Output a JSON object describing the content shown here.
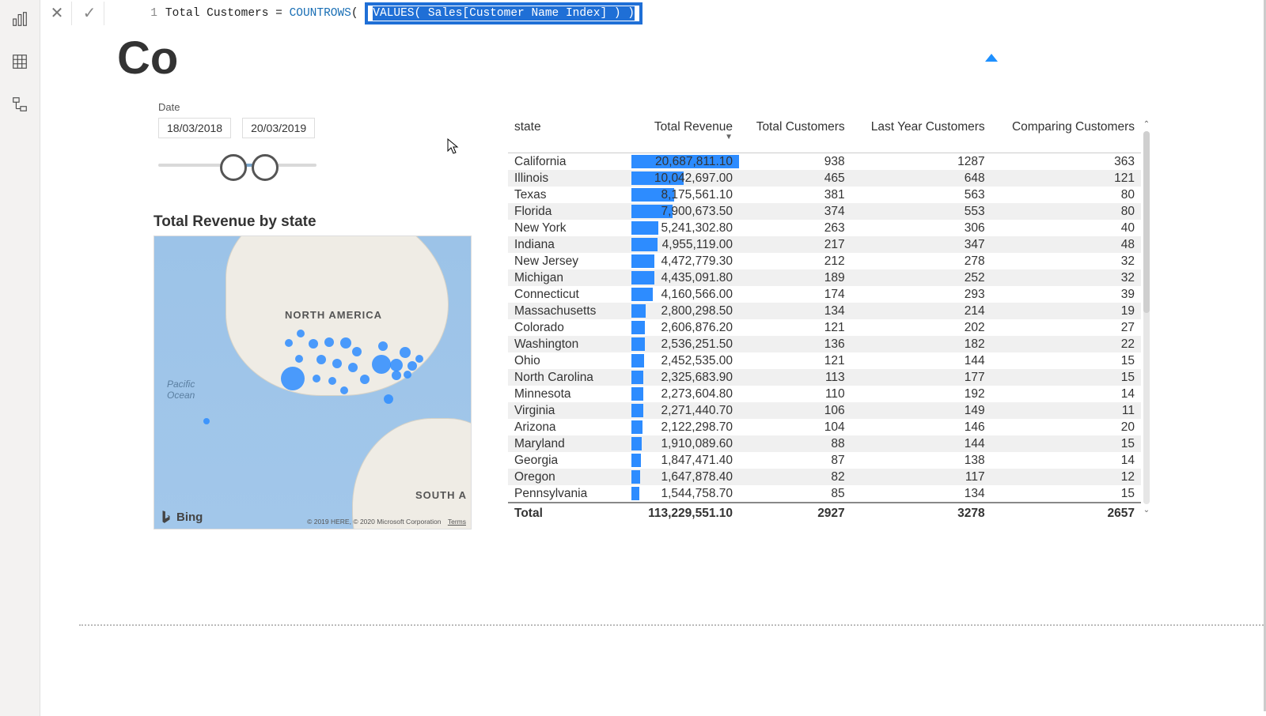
{
  "formula": {
    "line_no": "1",
    "measure_name": "Total Customers",
    "eq": " = ",
    "fn_left": "COUNTROWS",
    "paren_left": "( ",
    "fn_right": "VALUES",
    "inner_paren_l": "( ",
    "col_ref": "Sales[Customer Name Index]",
    "inner_paren_r": " )",
    "paren_right": " )"
  },
  "title_fragment": "Co",
  "date": {
    "label": "Date",
    "start": "18/03/2018",
    "end": "20/03/2019"
  },
  "map": {
    "title": "Total Revenue by state",
    "na_label": "NORTH AMERICA",
    "sa_label": "SOUTH A",
    "ocean_label": "Pacific\nOcean",
    "bing": "Bing",
    "credits": "© 2019 HERE, © 2020 Microsoft Corporation",
    "terms": "Terms"
  },
  "table": {
    "headers": {
      "state": "state",
      "rev": "Total Revenue",
      "cust": "Total Customers",
      "ly": "Last Year Customers",
      "comp": "Comparing Customers",
      "sort_glyph": "▼"
    },
    "rows": [
      {
        "state": "California",
        "revenue": "20,687,811.10",
        "cust": "938",
        "ly": "1287",
        "comp": "363"
      },
      {
        "state": "Illinois",
        "revenue": "10,042,697.00",
        "cust": "465",
        "ly": "648",
        "comp": "121"
      },
      {
        "state": "Texas",
        "revenue": "8,175,561.10",
        "cust": "381",
        "ly": "563",
        "comp": "80"
      },
      {
        "state": "Florida",
        "revenue": "7,900,673.50",
        "cust": "374",
        "ly": "553",
        "comp": "80"
      },
      {
        "state": "New York",
        "revenue": "5,241,302.80",
        "cust": "263",
        "ly": "306",
        "comp": "40"
      },
      {
        "state": "Indiana",
        "revenue": "4,955,119.00",
        "cust": "217",
        "ly": "347",
        "comp": "48"
      },
      {
        "state": "New Jersey",
        "revenue": "4,472,779.30",
        "cust": "212",
        "ly": "278",
        "comp": "32"
      },
      {
        "state": "Michigan",
        "revenue": "4,435,091.80",
        "cust": "189",
        "ly": "252",
        "comp": "32"
      },
      {
        "state": "Connecticut",
        "revenue": "4,160,566.00",
        "cust": "174",
        "ly": "293",
        "comp": "39"
      },
      {
        "state": "Massachusetts",
        "revenue": "2,800,298.50",
        "cust": "134",
        "ly": "214",
        "comp": "19"
      },
      {
        "state": "Colorado",
        "revenue": "2,606,876.20",
        "cust": "121",
        "ly": "202",
        "comp": "27"
      },
      {
        "state": "Washington",
        "revenue": "2,536,251.50",
        "cust": "136",
        "ly": "182",
        "comp": "22"
      },
      {
        "state": "Ohio",
        "revenue": "2,452,535.00",
        "cust": "121",
        "ly": "144",
        "comp": "15"
      },
      {
        "state": "North Carolina",
        "revenue": "2,325,683.90",
        "cust": "113",
        "ly": "177",
        "comp": "15"
      },
      {
        "state": "Minnesota",
        "revenue": "2,273,604.80",
        "cust": "110",
        "ly": "192",
        "comp": "14"
      },
      {
        "state": "Virginia",
        "revenue": "2,271,440.70",
        "cust": "106",
        "ly": "149",
        "comp": "11"
      },
      {
        "state": "Arizona",
        "revenue": "2,122,298.70",
        "cust": "104",
        "ly": "146",
        "comp": "20"
      },
      {
        "state": "Maryland",
        "revenue": "1,910,089.60",
        "cust": "88",
        "ly": "144",
        "comp": "15"
      },
      {
        "state": "Georgia",
        "revenue": "1,847,471.40",
        "cust": "87",
        "ly": "138",
        "comp": "14"
      },
      {
        "state": "Oregon",
        "revenue": "1,647,878.40",
        "cust": "82",
        "ly": "117",
        "comp": "12"
      },
      {
        "state": "Pennsylvania",
        "revenue": "1,544,758.70",
        "cust": "85",
        "ly": "134",
        "comp": "15"
      }
    ],
    "total": {
      "label": "Total",
      "revenue": "113,229,551.10",
      "cust": "2927",
      "ly": "3278",
      "comp": "2657"
    },
    "max_rev": 20687811.1
  },
  "chart_data": {
    "type": "table",
    "title": "Total Revenue by state",
    "columns": [
      "state",
      "Total Revenue",
      "Total Customers",
      "Last Year Customers",
      "Comparing Customers"
    ],
    "rows": [
      [
        "California",
        20687811.1,
        938,
        1287,
        363
      ],
      [
        "Illinois",
        10042697.0,
        465,
        648,
        121
      ],
      [
        "Texas",
        8175561.1,
        381,
        563,
        80
      ],
      [
        "Florida",
        7900673.5,
        374,
        553,
        80
      ],
      [
        "New York",
        5241302.8,
        263,
        306,
        40
      ],
      [
        "Indiana",
        4955119.0,
        217,
        347,
        48
      ],
      [
        "New Jersey",
        4472779.3,
        212,
        278,
        32
      ],
      [
        "Michigan",
        4435091.8,
        189,
        252,
        32
      ],
      [
        "Connecticut",
        4160566.0,
        174,
        293,
        39
      ],
      [
        "Massachusetts",
        2800298.5,
        134,
        214,
        19
      ],
      [
        "Colorado",
        2606876.2,
        121,
        202,
        27
      ],
      [
        "Washington",
        2536251.5,
        136,
        182,
        22
      ],
      [
        "Ohio",
        2452535.0,
        121,
        144,
        15
      ],
      [
        "North Carolina",
        2325683.9,
        113,
        177,
        15
      ],
      [
        "Minnesota",
        2273604.8,
        110,
        192,
        14
      ],
      [
        "Virginia",
        2271440.7,
        106,
        149,
        11
      ],
      [
        "Arizona",
        2122298.7,
        104,
        146,
        20
      ],
      [
        "Maryland",
        1910089.6,
        88,
        144,
        15
      ],
      [
        "Georgia",
        1847471.4,
        87,
        138,
        14
      ],
      [
        "Oregon",
        1647878.4,
        82,
        117,
        12
      ],
      [
        "Pennsylvania",
        1544758.7,
        85,
        134,
        15
      ]
    ],
    "totals": [
      "Total",
      113229551.1,
      2927,
      3278,
      2657
    ]
  }
}
